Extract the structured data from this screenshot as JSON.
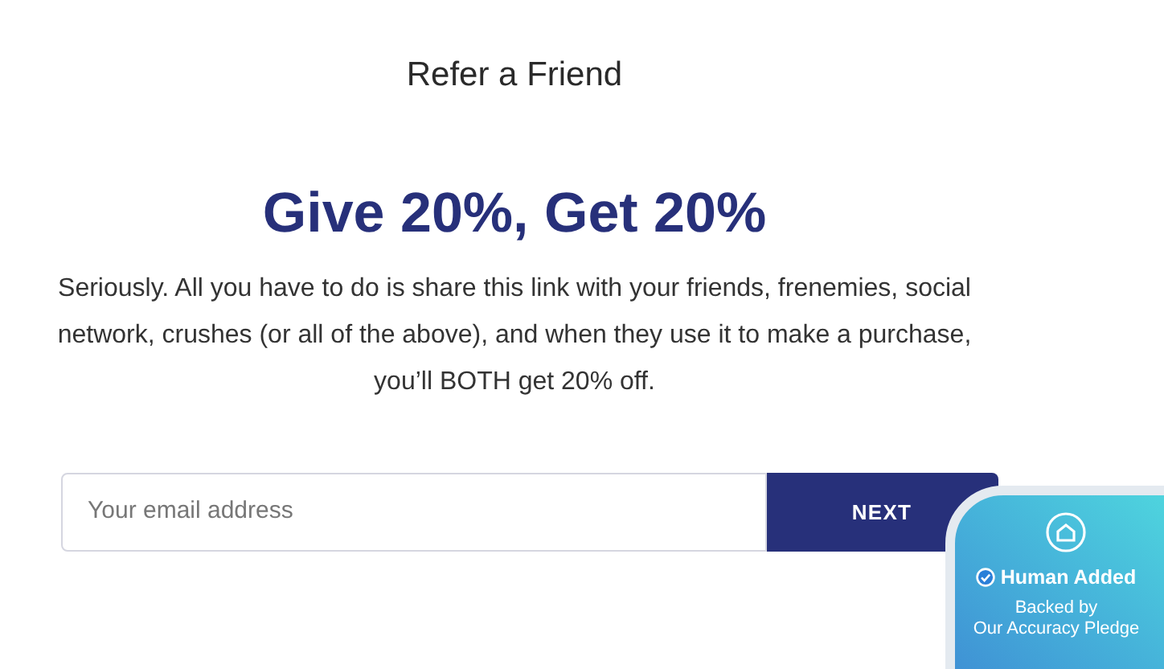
{
  "page_title": "Refer a Friend",
  "headline": "Give 20%, Get 20%",
  "description": "Seriously. All you have to do is share this link with your friends, frenemies, social network, crushes (or all of the above), and when they use it to make a purchase, you’ll BOTH get 20% off.",
  "form": {
    "email": {
      "placeholder": "Your email address"
    },
    "submit": "NEXT"
  },
  "badge": {
    "title": "Human Added",
    "subtitle_1": "Backed by",
    "subtitle_2": "Our Accuracy Pledge"
  }
}
